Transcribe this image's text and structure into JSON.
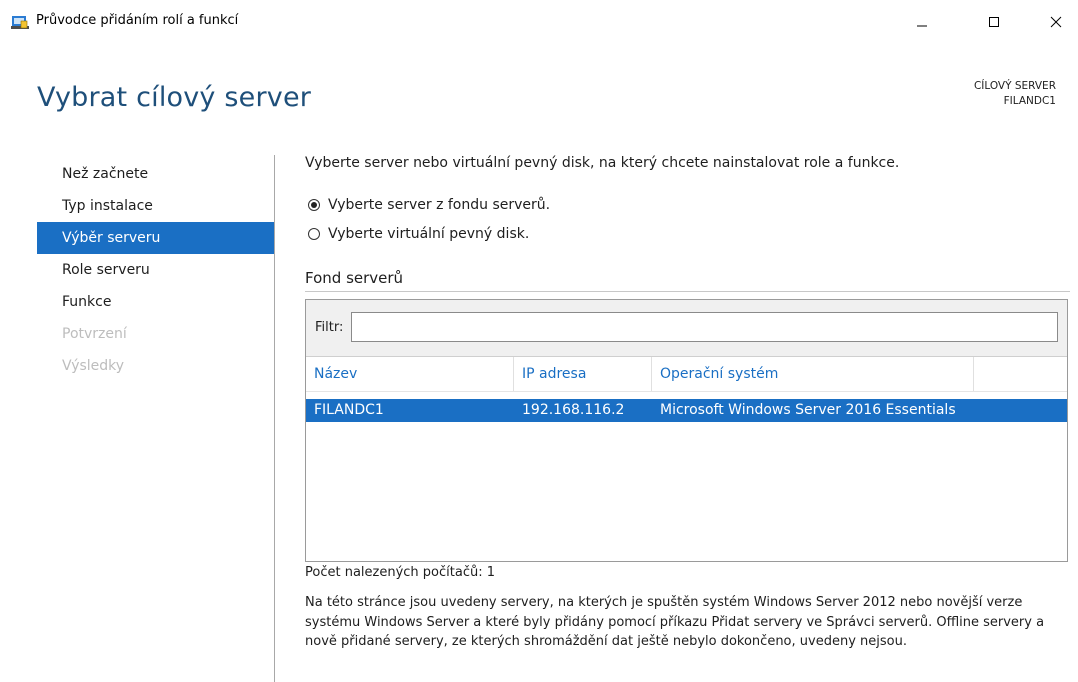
{
  "window": {
    "title": "Průvodce přidáním rolí a funkcí",
    "icon": "server-manager-icon",
    "controls": [
      "minimize-icon",
      "maximize-icon",
      "close-icon"
    ]
  },
  "header": {
    "page_title": "Vybrat cílový server",
    "target_label": "CÍLOVÝ SERVER",
    "target_name": "FILANDC1"
  },
  "nav": {
    "items": [
      {
        "label": "Než začnete",
        "state": "normal"
      },
      {
        "label": "Typ instalace",
        "state": "normal"
      },
      {
        "label": "Výběr serveru",
        "state": "active"
      },
      {
        "label": "Role serveru",
        "state": "normal"
      },
      {
        "label": "Funkce",
        "state": "normal"
      },
      {
        "label": "Potvrzení",
        "state": "disabled"
      },
      {
        "label": "Výsledky",
        "state": "disabled"
      }
    ]
  },
  "main": {
    "intro": "Vyberte server nebo virtuální pevný disk, na který chcete nainstalovat role a funkce.",
    "options": [
      {
        "label": "Vyberte server z fondu serverů.",
        "selected": true
      },
      {
        "label": "Vyberte virtuální pevný disk.",
        "selected": false
      }
    ],
    "pool_title": "Fond serverů",
    "filter_label": "Filtr:",
    "filter_value": "",
    "columns": [
      "Název",
      "IP adresa",
      "Operační systém"
    ],
    "rows": [
      {
        "name": "FILANDC1",
        "ip": "192.168.116.2",
        "os": "Microsoft Windows Server 2016 Essentials",
        "selected": true
      }
    ],
    "count_text": "Počet nalezených počítačů: 1",
    "note": "Na této stránce jsou uvedeny servery, na kterých je spuštěn systém Windows Server 2012 nebo novější verze systému Windows Server a které byly přidány pomocí příkazu Přidat servery ve Správci serverů. Offline servery a nově přidané servery, ze kterých shromáždění dat ještě nebylo dokončeno, uvedeny nejsou."
  },
  "colors": {
    "accent": "#1a6fc4",
    "title": "#1e4f7a",
    "disabled": "#bdbdbd"
  }
}
